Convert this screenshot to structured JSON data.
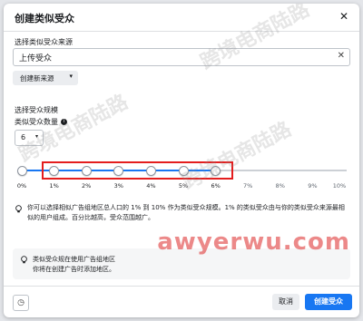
{
  "dialog": {
    "title": "创建类似受众",
    "close_icon": "close-icon"
  },
  "source": {
    "label": "选择类似受众来源",
    "value": "上传受众",
    "clear_icon": "clear-icon",
    "create_button": "创建新来源",
    "create_chevron": "▾"
  },
  "size": {
    "section_label": "选择受众规模",
    "count_label": "类似受众数量",
    "count_value": "6",
    "count_chevron": "▾"
  },
  "slider": {
    "min_percent": 0,
    "max_percent": 10,
    "handles_percent": [
      0,
      1,
      2,
      3,
      4,
      5,
      6
    ],
    "ticks": [
      "0%",
      "1%",
      "2%",
      "3%",
      "4%",
      "5%",
      "6%",
      "7%",
      "8%",
      "9%",
      "10%"
    ],
    "accent_color": "#1877f2",
    "highlight_color": "#e41e1e"
  },
  "note": {
    "text": "你可以选择相似广告组地区总人口的 1% 到 10% 作为类似受众规模。1% 的类似受众由与你的类似受众来源最相似的用户组成。百分比越高，受众范围越广。"
  },
  "warning": {
    "line1": "类似受众规在使用广告组地区",
    "line2": "你将在创建广告时添加地区。"
  },
  "footer": {
    "help_icon": "help-icon",
    "cancel": "取消",
    "create": "创建受众"
  },
  "watermark": {
    "text": "跨境电商陆路",
    "brand": "awyerwu.com"
  }
}
